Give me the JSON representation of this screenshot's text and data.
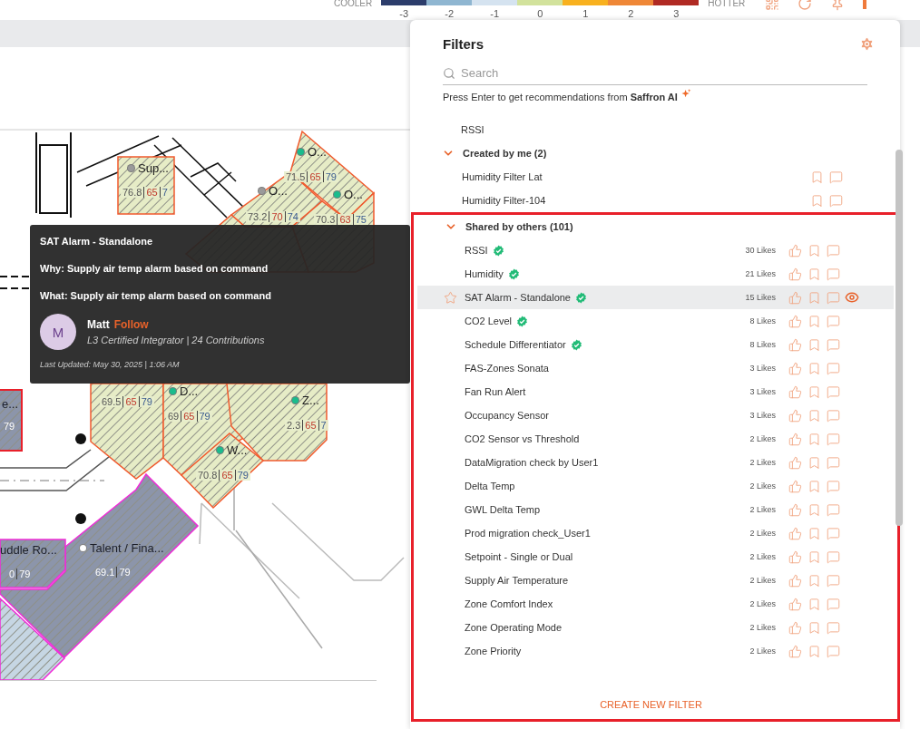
{
  "legend": {
    "low_label": "COOLER",
    "high_label": "HOTTER",
    "steps": [
      {
        "value": "-3",
        "color": "#2c3d6b"
      },
      {
        "value": "-2",
        "color": "#8fb6d1"
      },
      {
        "value": "-1",
        "color": "#d5e3f0"
      },
      {
        "value": "0",
        "color": "#d2e29c"
      },
      {
        "value": "1",
        "color": "#f8b11f"
      },
      {
        "value": "2",
        "color": "#ef8737"
      },
      {
        "value": "3",
        "color": "#b02a23"
      }
    ]
  },
  "map": {
    "zones": [
      {
        "label": "Sup...",
        "kind": "comfort",
        "color": "#9a9a9a",
        "readings": [
          "76.8",
          "65",
          "7"
        ]
      },
      {
        "label": "O...",
        "kind": "comfort",
        "color": "#1abc8c",
        "readings": [
          "71.5",
          "65",
          "79"
        ]
      },
      {
        "label": "O...",
        "kind": "comfort",
        "color": "#9a9a9a",
        "readings": [
          "73.2",
          "70",
          "74"
        ]
      },
      {
        "label": "O...",
        "kind": "comfort",
        "color": "#1abc8c",
        "readings": [
          "70.3",
          "63",
          "75"
        ]
      },
      {
        "kind": "comfort",
        "readings": [
          "69.5",
          "65",
          "79"
        ]
      },
      {
        "label": "D...",
        "kind": "comfort",
        "color": "#1abc8c",
        "readings": [
          "69",
          "65",
          "79"
        ]
      },
      {
        "label": "Z...",
        "kind": "comfort",
        "color": "#1abc8c",
        "readings": [
          "2.3",
          "65",
          "7"
        ]
      },
      {
        "label": "W...",
        "kind": "comfort",
        "color": "#1abc8c",
        "readings": [
          "70.8",
          "65",
          "79"
        ]
      },
      {
        "label": "e...",
        "kind": "idle",
        "readings": [
          "79"
        ]
      },
      {
        "label": "uddle Ro...",
        "kind": "idle",
        "readings": [
          "0",
          "79"
        ]
      },
      {
        "label": "Talent / Fina...",
        "kind": "idle",
        "color": "#ffffff",
        "readings": [
          "69.1",
          "79"
        ]
      }
    ]
  },
  "tooltip": {
    "title": "SAT Alarm - Standalone",
    "why": "Why: Supply air temp alarm based on command",
    "what": "What: Supply air temp alarm based on command",
    "author": {
      "initial": "M",
      "name": "Matt",
      "follow": "Follow",
      "credentials": "L3 Certified Integrator | 24 Contributions"
    },
    "updated": "Last Updated: May 30, 2025 | 1:06 AM"
  },
  "filters": {
    "title": "Filters",
    "search": {
      "placeholder": "Search"
    },
    "hint": "Press Enter to get recommendations from **Saffron AI**",
    "top_items": [
      {
        "name": "RSSI"
      }
    ],
    "sections": [
      {
        "title": "Created by me (2)",
        "expanded": true,
        "highlighted": false,
        "items": [
          {
            "kind": "own",
            "name": "Humidity Filter Lat",
            "selected": false
          },
          {
            "kind": "own",
            "name": "Humidity Filter-104",
            "selected": false
          }
        ]
      },
      {
        "title": "Shared by others (101)",
        "expanded": true,
        "highlighted": true,
        "items": [
          {
            "kind": "shared",
            "name": "RSSI",
            "verified": true,
            "likes": "30 Likes",
            "selected": false
          },
          {
            "kind": "shared",
            "name": "Humidity",
            "verified": true,
            "likes": "21 Likes",
            "selected": false
          },
          {
            "kind": "shared",
            "name": "SAT Alarm - Standalone",
            "verified": true,
            "likes": "15 Likes",
            "selected": true
          },
          {
            "kind": "shared",
            "name": "CO2 Level",
            "verified": true,
            "likes": "8 Likes",
            "selected": false
          },
          {
            "kind": "shared",
            "name": "Schedule Differentiator",
            "verified": true,
            "likes": "8 Likes",
            "selected": false
          },
          {
            "kind": "shared",
            "name": "FAS-Zones Sonata",
            "verified": false,
            "likes": "3 Likes",
            "selected": false
          },
          {
            "kind": "shared",
            "name": "Fan Run Alert",
            "verified": false,
            "likes": "3 Likes",
            "selected": false
          },
          {
            "kind": "shared",
            "name": "Occupancy Sensor",
            "verified": false,
            "likes": "3 Likes",
            "selected": false
          },
          {
            "kind": "shared",
            "name": "CO2 Sensor vs Threshold",
            "verified": false,
            "likes": "2 Likes",
            "selected": false
          },
          {
            "kind": "shared",
            "name": "DataMigration check by User1",
            "verified": false,
            "likes": "2 Likes",
            "selected": false
          },
          {
            "kind": "shared",
            "name": "Delta Temp",
            "verified": false,
            "likes": "2 Likes",
            "selected": false
          },
          {
            "kind": "shared",
            "name": "GWL Delta Temp",
            "verified": false,
            "likes": "2 Likes",
            "selected": false
          },
          {
            "kind": "shared",
            "name": "Prod migration check_User1",
            "verified": false,
            "likes": "2 Likes",
            "selected": false
          },
          {
            "kind": "shared",
            "name": "Setpoint - Single or Dual",
            "verified": false,
            "likes": "2 Likes",
            "selected": false
          },
          {
            "kind": "shared",
            "name": "Supply Air Temperature",
            "verified": false,
            "likes": "2 Likes",
            "selected": false
          },
          {
            "kind": "shared",
            "name": "Zone Comfort Index",
            "verified": false,
            "likes": "2 Likes",
            "selected": false
          },
          {
            "kind": "shared",
            "name": "Zone Operating Mode",
            "verified": false,
            "likes": "2 Likes",
            "selected": false
          },
          {
            "kind": "shared",
            "name": "Zone Priority",
            "verified": false,
            "likes": "2 Likes",
            "selected": false
          }
        ]
      }
    ],
    "create_button": "CREATE NEW FILTER"
  }
}
